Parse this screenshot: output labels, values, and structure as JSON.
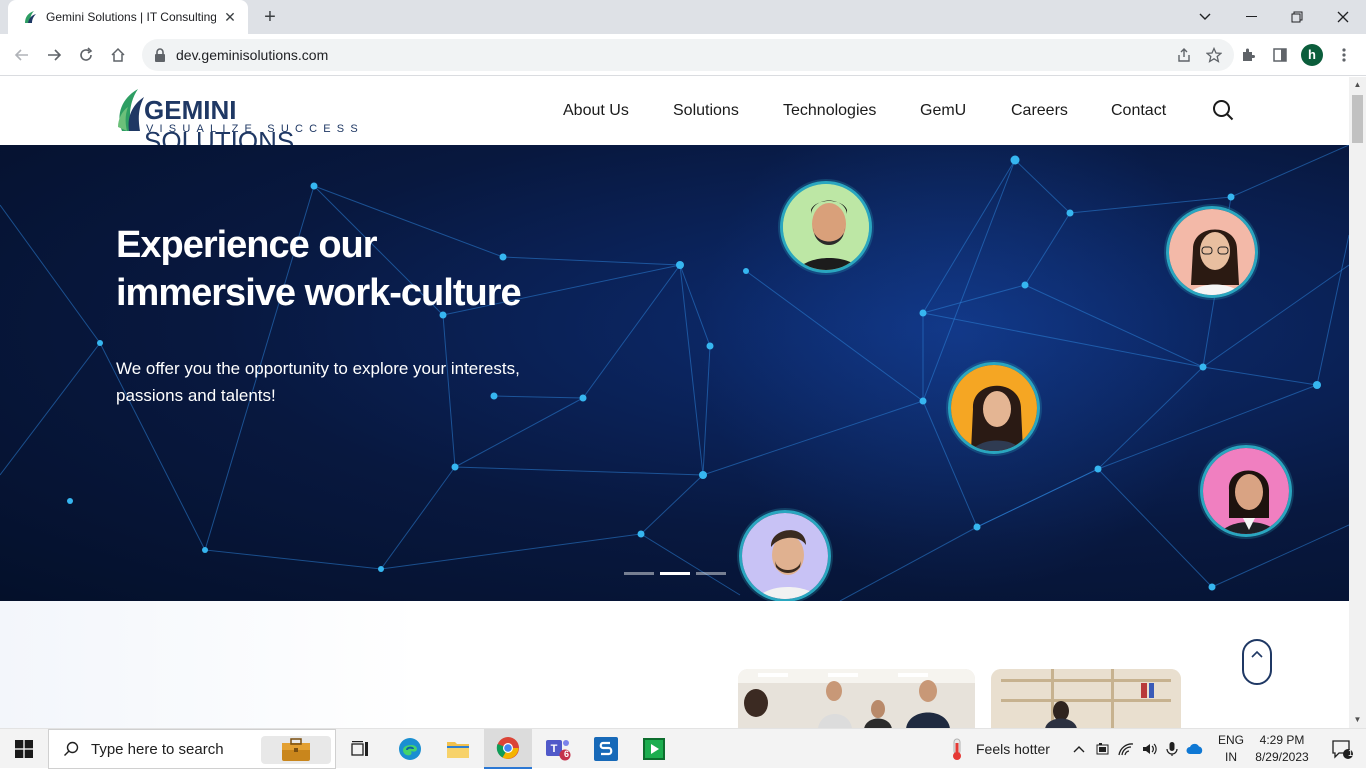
{
  "browser": {
    "tab_title": "Gemini Solutions | IT Consulting,",
    "url": "dev.geminisolutions.com",
    "profile_initial": "h"
  },
  "site": {
    "logo_word_bold": "GEMINI",
    "logo_word_rest": " SOLUTIONS",
    "logo_tagline": "VISUALIZE SUCCESS",
    "nav": [
      "About Us",
      "Solutions",
      "Technologies",
      "GemU",
      "Careers",
      "Contact"
    ]
  },
  "hero": {
    "heading_line1": "Experience our",
    "heading_line2": "immersive work-culture",
    "body": "We offer you the opportunity to explore your interests, passions and talents!",
    "slide_count": 3,
    "active_slide": 2
  },
  "taskbar": {
    "search_placeholder": "Type here to search",
    "weather": "Feels hotter",
    "lang_line1": "ENG",
    "lang_line2": "IN",
    "time": "4:29 PM",
    "date": "8/29/2023",
    "teams_badge": "6",
    "notification_count": "1"
  },
  "colors": {
    "brand_navy": "#1f3864",
    "brand_green": "#2e9e63",
    "hero_bg": "#08183f",
    "network_line": "#2c7fd6",
    "node_dot": "#36b6f0",
    "avatar_ring": "#2aa6bf"
  }
}
